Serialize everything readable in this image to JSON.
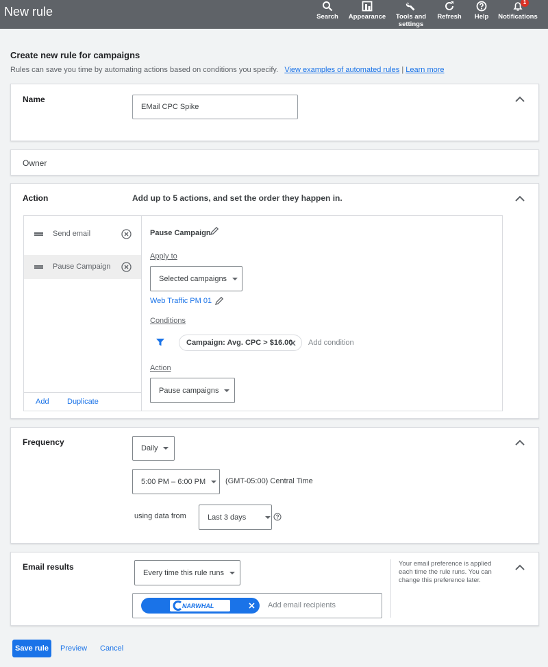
{
  "topbar": {
    "title": "New rule",
    "items": [
      {
        "label": "Search",
        "icon": "search-icon"
      },
      {
        "label": "Appearance",
        "icon": "appearance-icon"
      },
      {
        "label": "Tools and settings",
        "line1": "Tools and",
        "line2": "settings",
        "icon": "wrench-icon"
      },
      {
        "label": "Refresh",
        "icon": "refresh-icon"
      },
      {
        "label": "Help",
        "icon": "help-icon"
      },
      {
        "label": "Notifications",
        "icon": "bell-icon",
        "badge": "1"
      }
    ]
  },
  "header": {
    "title": "Create new rule for campaigns",
    "description": "Rules can save you time by automating actions based on conditions you specify.",
    "link1": "View examples of automated rules",
    "separator": "|",
    "link2": "Learn more"
  },
  "name_section": {
    "label": "Name",
    "value": "EMail CPC Spike"
  },
  "owner_section": {
    "label": "Owner"
  },
  "action_section": {
    "label": "Action",
    "hint": "Add up to 5 actions, and set the order they happen in.",
    "list": [
      "Send email",
      "Pause Campaign"
    ],
    "add_label": "Add",
    "duplicate_label": "Duplicate",
    "detail": {
      "title": "Pause Campaign",
      "apply_to_label": "Apply to",
      "apply_to_value": "Selected campaigns",
      "campaign_link": "Web Traffic PM 01",
      "conditions_label": "Conditions",
      "condition_chip": "Campaign: Avg. CPC > $16.00",
      "add_condition": "Add condition",
      "action_label": "Action",
      "action_value": "Pause campaigns"
    }
  },
  "frequency_section": {
    "label": "Frequency",
    "freq_value": "Daily",
    "time_value": "5:00 PM – 6:00 PM",
    "timezone": "(GMT-05:00) Central Time",
    "using_data_label": "using data from",
    "range_value": "Last 3 days"
  },
  "email_section": {
    "label": "Email results",
    "when_value": "Every time this rule runs",
    "recipient_chip": "NARWHAL",
    "add_recipients": "Add email recipients",
    "note": "Your email preference is applied each time the rule runs. You can change this preference later."
  },
  "footer": {
    "save": "Save rule",
    "preview": "Preview",
    "cancel": "Cancel"
  },
  "colors": {
    "topbar": "#5f6368",
    "accent": "#1a73e8",
    "badge": "#d93025"
  }
}
